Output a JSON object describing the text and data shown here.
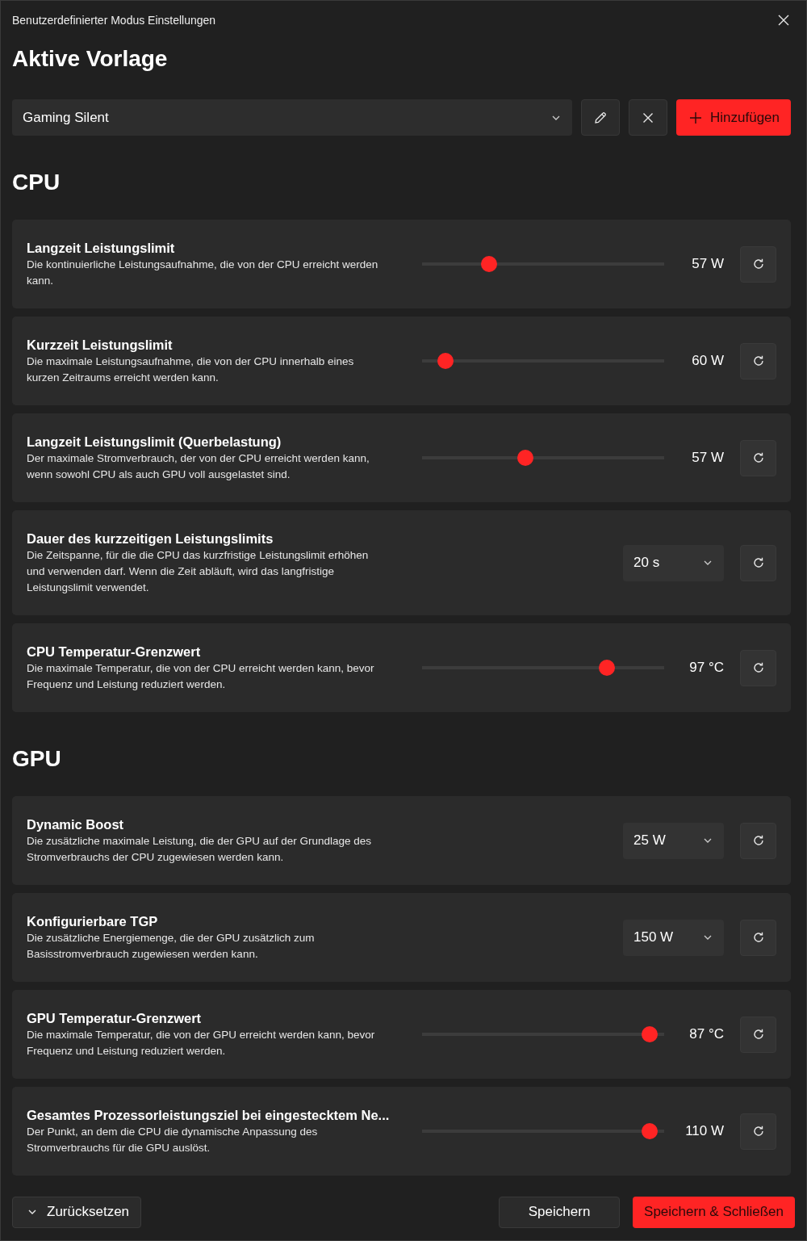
{
  "window": {
    "title": "Benutzerdefinierter Modus Einstellungen"
  },
  "heading": "Aktive Vorlage",
  "template": {
    "value": "Gaming Silent",
    "add_label": "Hinzufügen"
  },
  "sections": [
    {
      "title": "CPU",
      "settings": [
        {
          "kind": "slider",
          "title": "Langzeit Leistungslimit",
          "description": "Die kontinuierliche Leistungsaufnahme, die von der CPU erreicht werden kann.",
          "level": 0.26,
          "value": "57 W"
        },
        {
          "kind": "slider",
          "title": "Kurzzeit Leistungslimit",
          "description": "Die maximale Leistungsaufnahme, die von der CPU innerhalb eines kurzen Zeitraums erreicht werden kann.",
          "level": 0.067,
          "value": "60 W"
        },
        {
          "kind": "slider",
          "title": "Langzeit Leistungslimit (Querbelastung)",
          "description": "Der maximale Stromverbrauch, der von der CPU erreicht werden kann, wenn sowohl CPU als auch GPU voll ausgelastet sind.",
          "level": 0.42,
          "value": "57 W"
        },
        {
          "kind": "dropdown",
          "title": "Dauer des kurzzeitigen Leistungslimits",
          "description": "Die Zeitspanne, für die die CPU das kurzfristige Leistungslimit erhöhen und verwenden darf. Wenn die Zeit abläuft, wird das langfristige Leistungslimit verwendet.",
          "value": "20 s"
        },
        {
          "kind": "slider",
          "title": "CPU Temperatur-Grenzwert",
          "description": "Die maximale Temperatur, die von der CPU erreicht werden kann, bevor Frequenz und Leistung reduziert werden.",
          "level": 0.783,
          "value": "97 °C"
        }
      ]
    },
    {
      "title": "GPU",
      "settings": [
        {
          "kind": "dropdown",
          "title": "Dynamic Boost",
          "description": "Die zusätzliche maximale Leistung, die der GPU auf der Grundlage des Stromverbrauchs der CPU zugewiesen werden kann.",
          "value": "25 W"
        },
        {
          "kind": "dropdown",
          "title": "Konfigurierbare TGP",
          "description": "Die zusätzliche Energiemenge, die der GPU zusätzlich zum Basisstromverbrauch zugewiesen werden kann.",
          "value": "150 W"
        },
        {
          "kind": "slider",
          "title": "GPU Temperatur-Grenzwert",
          "description": "Die maximale Temperatur, die von der GPU erreicht werden kann, bevor Frequenz und Leistung reduziert werden.",
          "level": 0.97,
          "value": "87 °C"
        },
        {
          "kind": "slider",
          "title": "Gesamtes Prozessorleistungsziel bei eingestecktem Ne...",
          "description": "Der Punkt, an dem die CPU die dynamische Anpassung des Stromverbrauchs für die GPU auslöst.",
          "level": 0.97,
          "value": "110 W"
        }
      ]
    }
  ],
  "footer": {
    "reset_label": "Zurücksetzen",
    "save_label": "Speichern",
    "save_close_label": "Speichern & Schließen"
  }
}
